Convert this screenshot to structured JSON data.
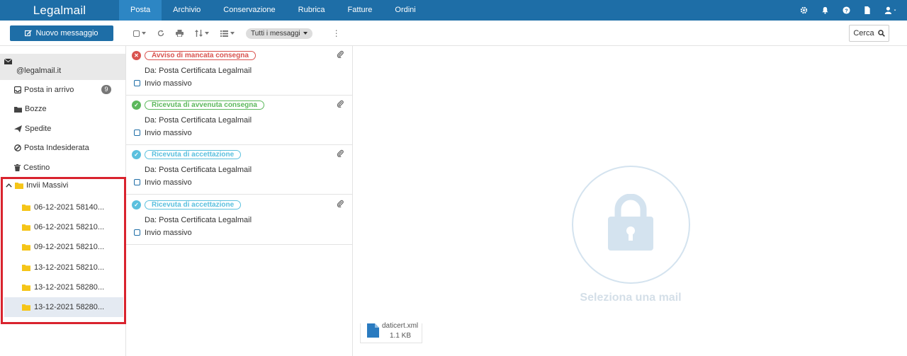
{
  "app": {
    "logo": "Legalmail"
  },
  "nav": {
    "tabs": [
      {
        "label": "Posta",
        "active": true
      },
      {
        "label": "Archivio"
      },
      {
        "label": "Conservazione"
      },
      {
        "label": "Rubrica"
      },
      {
        "label": "Fatture"
      },
      {
        "label": "Ordini"
      }
    ],
    "icons": [
      "gear-icon",
      "bell-icon",
      "help-icon",
      "document-icon",
      "user-icon"
    ]
  },
  "toolbar": {
    "new_message_label": "Nuovo messaggio",
    "filter_label": "Tutti i messaggi",
    "search_label": "Cerca"
  },
  "sidebar": {
    "account": "@legalmail.it",
    "inbox": {
      "label": "Posta in arrivo",
      "count": "9"
    },
    "drafts": "Bozze",
    "sent": "Spedite",
    "spam": "Posta Indesiderata",
    "trash": "Cestino",
    "group": {
      "label": "Invii Massivi",
      "items": [
        "06-12-2021 58140...",
        "06-12-2021 58210...",
        "09-12-2021 58210...",
        "13-12-2021 58210...",
        "13-12-2021 58280...",
        "13-12-2021 58280..."
      ]
    }
  },
  "messages": [
    {
      "tag": "Avviso di mancata consegna",
      "from": "Da: Posta Certificata Legalmail",
      "subject": "Invio massivo",
      "status": "error",
      "color": "#d9534f"
    },
    {
      "tag": "Ricevuta di avvenuta consegna",
      "from": "Da: Posta Certificata Legalmail",
      "subject": "Invio massivo",
      "status": "delivered",
      "color": "#5cb85c"
    },
    {
      "tag": "Ricevuta di accettazione",
      "from": "Da: Posta Certificata Legalmail",
      "subject": "Invio massivo",
      "status": "accepted",
      "color": "#5bc0de"
    },
    {
      "tag": "Ricevuta di accettazione",
      "from": "Da: Posta Certificata Legalmail",
      "subject": "Invio massivo",
      "status": "accepted",
      "color": "#5bc0de"
    }
  ],
  "preview": {
    "empty_text": "Seleziona una mail",
    "attachment": {
      "name": "daticert.xml",
      "size": "1.1 KB"
    }
  },
  "colors": {
    "brand": "#1e6ea7",
    "highlight_box": "#d9232e"
  }
}
